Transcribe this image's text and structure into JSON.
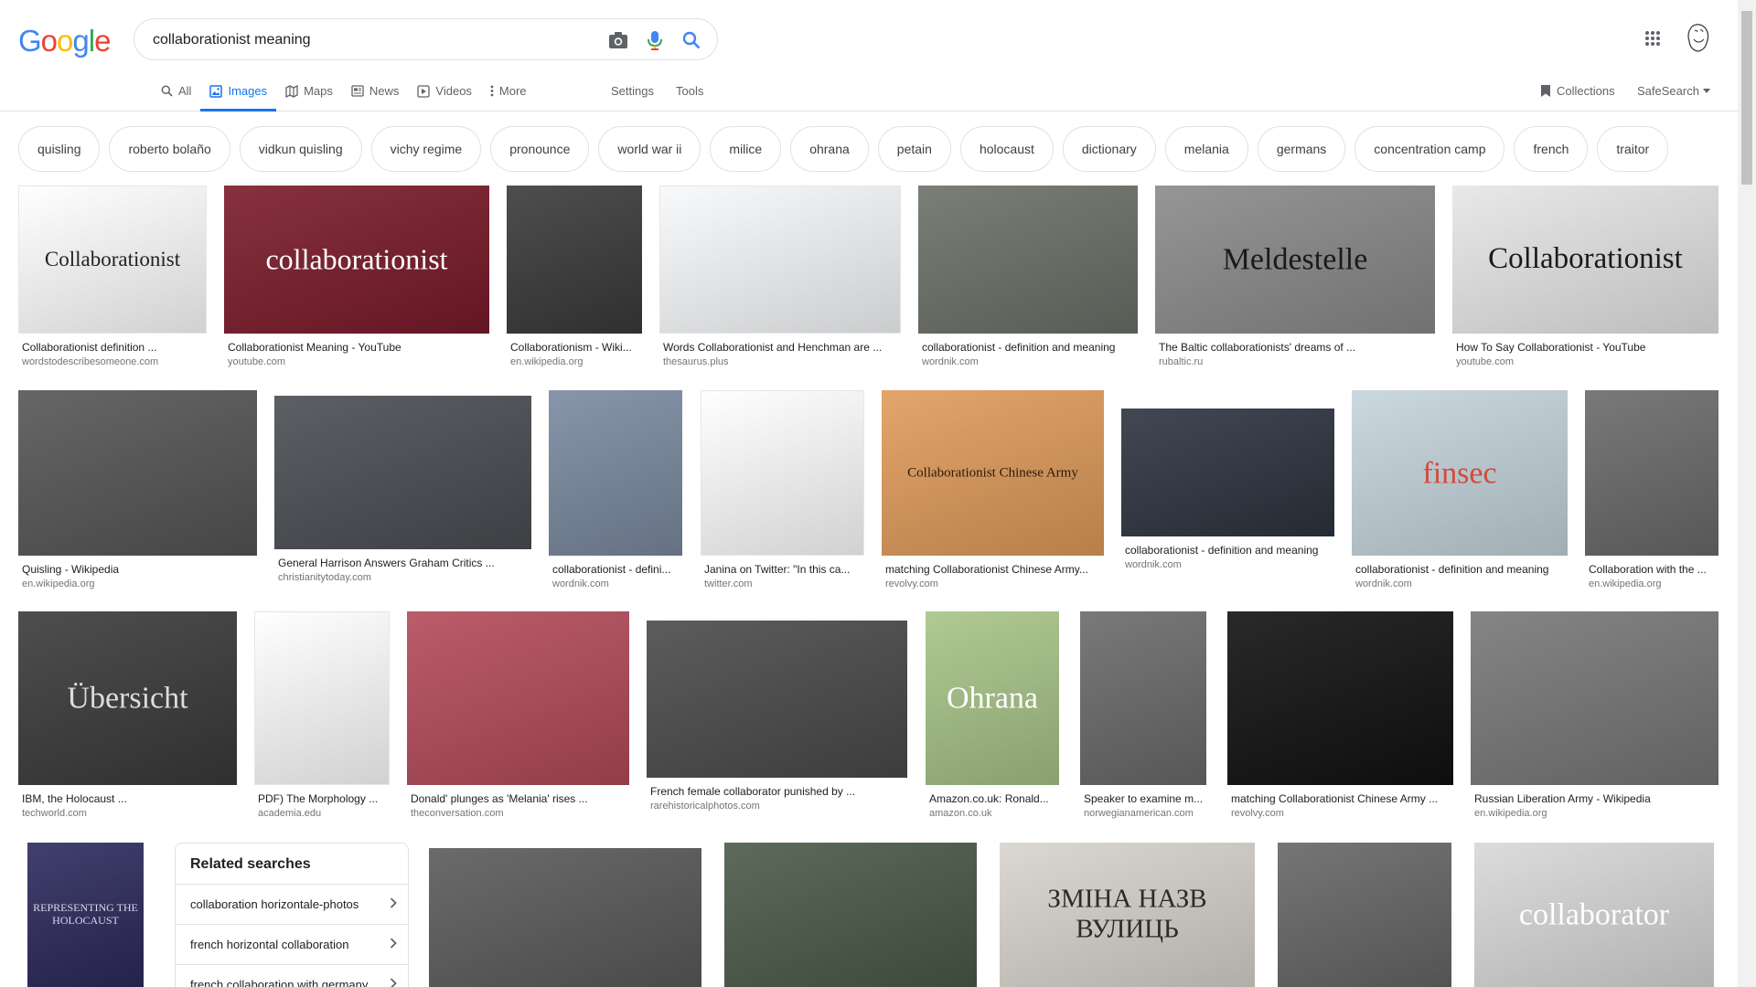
{
  "header": {
    "logo_letters": [
      "G",
      "o",
      "o",
      "g",
      "l",
      "e"
    ],
    "logo_colors": [
      "#4285F4",
      "#EA4335",
      "#FBBC05",
      "#4285F4",
      "#34A853",
      "#EA4335"
    ],
    "query": "collaborationist meaning"
  },
  "tabs": {
    "items": [
      {
        "label": "All",
        "icon": "search-icon"
      },
      {
        "label": "Images",
        "icon": "image-icon",
        "active": true
      },
      {
        "label": "Maps",
        "icon": "map-icon"
      },
      {
        "label": "News",
        "icon": "news-icon"
      },
      {
        "label": "Videos",
        "icon": "video-icon"
      },
      {
        "label": "More",
        "icon": "more-vert-icon"
      }
    ],
    "settings": "Settings",
    "tools": "Tools",
    "collections": "Collections",
    "safesearch": "SafeSearch"
  },
  "chips": [
    "quisling",
    "roberto bolaño",
    "vidkun quisling",
    "vichy regime",
    "pronounce",
    "world war ii",
    "milice",
    "ohrana",
    "petain",
    "holocaust",
    "dictionary",
    "melania",
    "germans",
    "concentration camp",
    "french",
    "traitor"
  ],
  "results": [
    {
      "caption": "Collaborationist definition ...",
      "source": "wordstodescribesomeone.com",
      "thumb_text": "Collaborationist",
      "bg": "#ffffff",
      "fg": "#222222"
    },
    {
      "caption": "Collaborationist Meaning - YouTube",
      "source": "youtube.com",
      "thumb_text": "collaborationist",
      "bg": "#7a1a2a",
      "fg": "#ffffff"
    },
    {
      "caption": "Collaborationism - Wiki...",
      "source": "en.wikipedia.org",
      "bg": "#3a3a3a"
    },
    {
      "caption": "Words Collaborationist and Henchman are ...",
      "source": "thesaurus.plus",
      "bg": "#f7f9fb"
    },
    {
      "caption": "collaborationist - definition and meaning",
      "source": "wordnik.com",
      "bg": "#6b7068"
    },
    {
      "caption": "The Baltic collaborationists' dreams of ...",
      "source": "rubaltic.ru",
      "thumb_text": "Meldestelle",
      "bg": "#8a8a8a",
      "fg": "#1a1a1a"
    },
    {
      "caption": "How To Say Collaborationist - YouTube",
      "source": "youtube.com",
      "thumb_text": "Collaborationist",
      "bg": "#e6e6e6",
      "fg": "#1a1a1a"
    },
    {
      "caption": "Quisling - Wikipedia",
      "source": "en.wikipedia.org",
      "bg": "#555555"
    },
    {
      "caption": "General Harrison Answers Graham Critics ...",
      "source": "christianitytoday.com",
      "bg": "#4a4d52"
    },
    {
      "caption": "collaborationist - defini...",
      "source": "wordnik.com",
      "bg": "#7b8aa0"
    },
    {
      "caption": "Janina on Twitter: \"In this ca...",
      "source": "twitter.com",
      "bg": "#ffffff"
    },
    {
      "caption": "matching Collaborationist Chinese Army...",
      "source": "revolvy.com",
      "thumb_text": "Collaborationist Chinese Army",
      "bg": "#e09b5a",
      "fg": "#2a1a0a"
    },
    {
      "caption": "collaborationist - definition and meaning",
      "source": "wordnik.com",
      "bg": "#2c3440"
    },
    {
      "caption": "collaborationist - definition and meaning",
      "source": "wordnik.com",
      "thumb_text": "finsec",
      "bg": "#c5d4dc",
      "fg": "#d24a3a"
    },
    {
      "caption": "Collaboration with the ...",
      "source": "en.wikipedia.org",
      "bg": "#6a6a6a"
    },
    {
      "caption": "IBM, the Holocaust ...",
      "source": "techworld.com",
      "thumb_text": "Übersicht",
      "bg": "#3a3a3a",
      "fg": "#dddddd"
    },
    {
      "caption": "PDF) The Morphology ...",
      "source": "academia.edu",
      "bg": "#ffffff"
    },
    {
      "caption": "Donald' plunges as 'Melania' rises ...",
      "source": "theconversation.com",
      "bg": "#b34a5a"
    },
    {
      "caption": "French female collaborator punished by ...",
      "source": "rarehistoricalphotos.com",
      "bg": "#4a4a4a"
    },
    {
      "caption": "Amazon.co.uk: Ronald...",
      "source": "amazon.co.uk",
      "thumb_text": "Ohrana",
      "bg": "#a8c488",
      "fg": "#ffffff"
    },
    {
      "caption": "Speaker to examine m...",
      "source": "norwegianamerican.com",
      "bg": "#6a6a6a"
    },
    {
      "caption": "matching Collaborationist Chinese Army ...",
      "source": "revolvy.com",
      "bg": "#111111"
    },
    {
      "caption": "Russian Liberation Army - Wikipedia",
      "source": "en.wikipedia.org",
      "bg": "#777777"
    },
    {
      "caption": "",
      "source": "",
      "thumb_text": "REPRESENTING THE HOLOCAUST",
      "bg": "#2c2a5c",
      "fg": "#d8d8f0"
    },
    {
      "caption": "",
      "source": "",
      "bg": "#5a5a5a"
    },
    {
      "caption": "",
      "source": "",
      "bg": "#4a5a48"
    },
    {
      "caption": "",
      "source": "",
      "thumb_text": "ЗМІНА НАЗВ ВУЛИЦЬ",
      "bg": "#d8d4cc",
      "fg": "#2a2a2a"
    },
    {
      "caption": "",
      "source": "",
      "bg": "#666666"
    },
    {
      "caption": "",
      "source": "",
      "thumb_text": "collaborator",
      "bg": "#d8d8d8",
      "fg": "#ffffff"
    }
  ],
  "related": {
    "title": "Related searches",
    "items": [
      "collaboration horizontale-photos",
      "french horizontal collaboration",
      "french collaboration with germany"
    ]
  }
}
